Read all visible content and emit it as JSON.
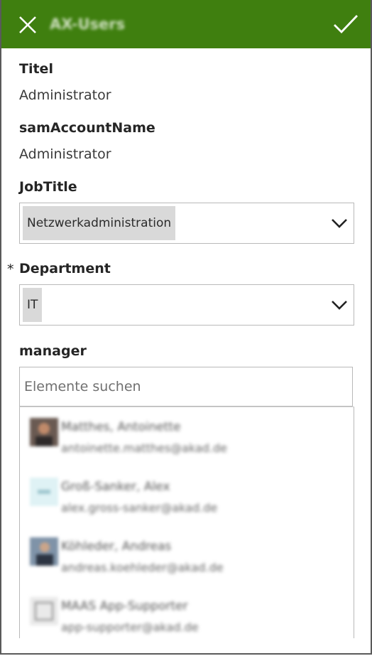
{
  "header": {
    "title": "AX-Users",
    "close_icon": "close-icon",
    "submit_icon": "checkmark-icon",
    "color": "#3f7f0f"
  },
  "fields": {
    "titel": {
      "label": "Titel",
      "value": "Administrator"
    },
    "sam": {
      "label": "samAccountName",
      "value": "Administrator"
    },
    "jobtitle": {
      "label": "JobTitle",
      "value": "Netzwerkadministration"
    },
    "department": {
      "label": "Department",
      "value": "IT",
      "required_marker": "*"
    },
    "manager": {
      "label": "manager",
      "placeholder": "Elemente suchen"
    }
  },
  "manager_results": [
    {
      "name": "Matthes, Antoinette",
      "email": "antoinette.matthes@akad.de",
      "avatar": "person-photo"
    },
    {
      "name": "Groß-Sanker, Alex",
      "email": "alex.gross-sanker@akad.de",
      "avatar": "initials-avatar"
    },
    {
      "name": "Köhleder, Andreas",
      "email": "andreas.koehleder@akad.de",
      "avatar": "person-photo"
    },
    {
      "name": "MAAS App-Supporter",
      "email": "app-supporter@akad.de",
      "avatar": "generic-avatar"
    }
  ]
}
